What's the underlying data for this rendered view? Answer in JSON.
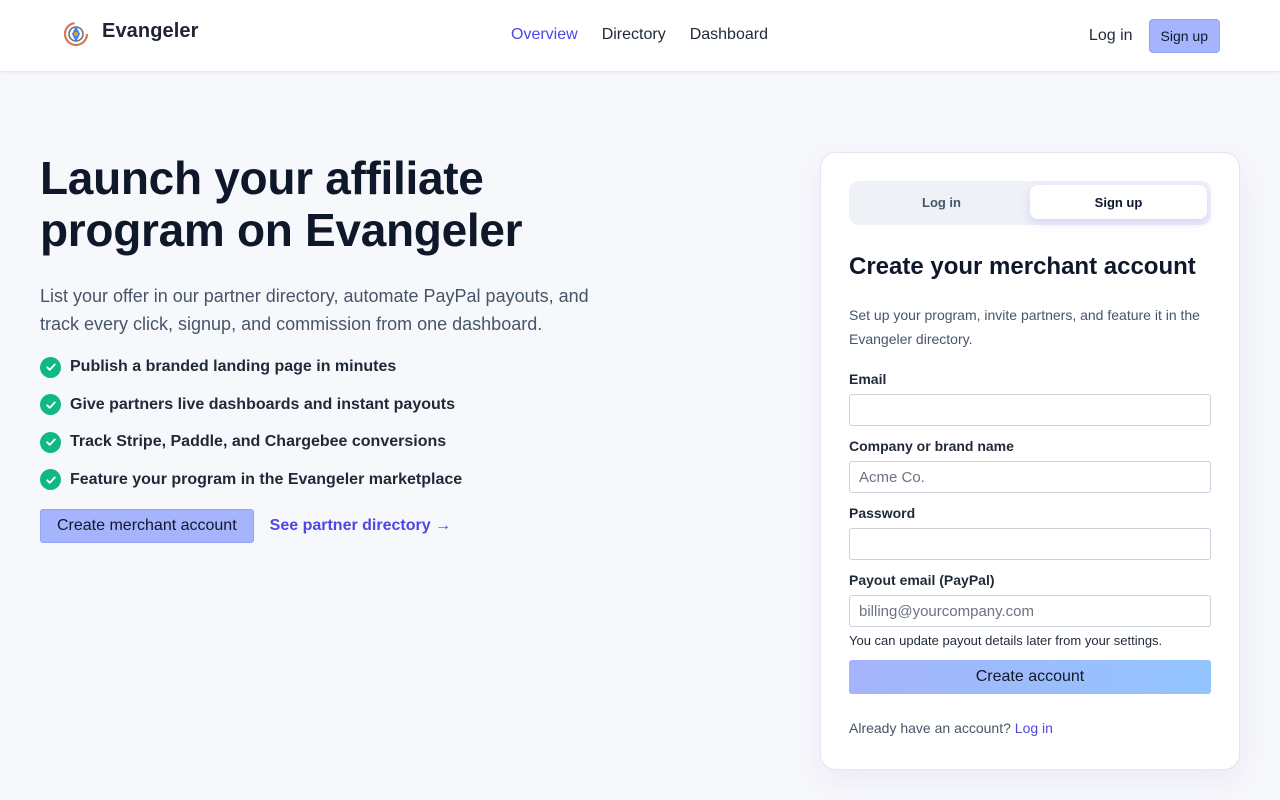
{
  "header": {
    "brand_name": "Evangeler",
    "nav": [
      {
        "label": "Overview",
        "active": true
      },
      {
        "label": "Directory",
        "active": false
      },
      {
        "label": "Dashboard",
        "active": false
      }
    ],
    "login_label": "Log in",
    "signup_label": "Sign up"
  },
  "hero": {
    "title": "Launch your affiliate program on Evangeler",
    "lead": "List your offer in our partner directory, automate PayPal payouts, and track every click, signup, and commission from one dashboard.",
    "features": [
      "Publish a branded landing page in minutes",
      "Give partners live dashboards and instant payouts",
      "Track Stripe, Paddle, and Chargebee conversions",
      "Feature your program in the Evangeler marketplace"
    ],
    "cta_primary": "Create merchant account",
    "cta_secondary": "See partner directory →"
  },
  "card": {
    "tabs": {
      "login": "Log in",
      "signup": "Sign up",
      "active": "signup"
    },
    "title": "Create your merchant account",
    "subtitle": "Set up your program, invite partners, and feature it in the Evangeler directory.",
    "fields": {
      "email": {
        "label": "Email",
        "value": "",
        "placeholder": ""
      },
      "company": {
        "label": "Company or brand name",
        "value": "",
        "placeholder": "Acme Co."
      },
      "password": {
        "label": "Password",
        "value": "",
        "placeholder": ""
      },
      "payout": {
        "label": "Payout email (PayPal)",
        "value": "",
        "placeholder": "billing@yourcompany.com"
      }
    },
    "helper": "You can update payout details later from your settings.",
    "submit_label": "Create account",
    "footer_text": "Already have an account?",
    "footer_link": "Log in"
  },
  "colors": {
    "accent": "#4f46e5",
    "button": "#a5b4fc",
    "check": "#10b981",
    "background": "#f7f8fb"
  },
  "icons": {
    "logo": "evangeler-logo",
    "feature": "check-circle-icon"
  }
}
